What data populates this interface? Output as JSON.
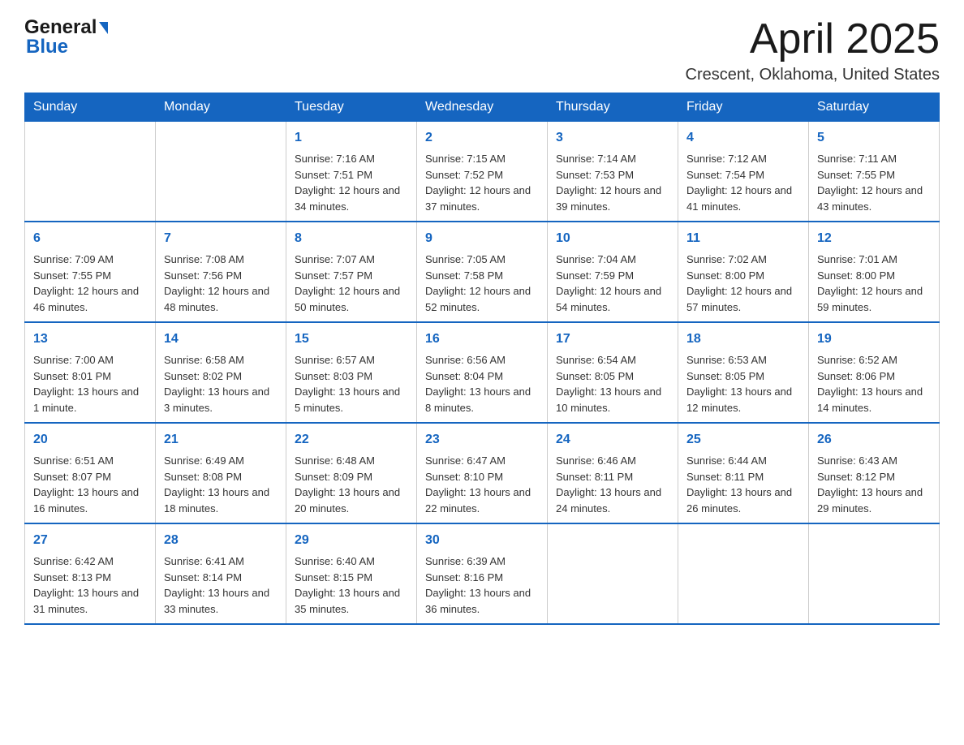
{
  "header": {
    "logo_line1": "General",
    "logo_line2": "Blue",
    "month_title": "April 2025",
    "location": "Crescent, Oklahoma, United States"
  },
  "weekdays": [
    "Sunday",
    "Monday",
    "Tuesday",
    "Wednesday",
    "Thursday",
    "Friday",
    "Saturday"
  ],
  "weeks": [
    [
      {
        "day": "",
        "sunrise": "",
        "sunset": "",
        "daylight": ""
      },
      {
        "day": "",
        "sunrise": "",
        "sunset": "",
        "daylight": ""
      },
      {
        "day": "1",
        "sunrise": "Sunrise: 7:16 AM",
        "sunset": "Sunset: 7:51 PM",
        "daylight": "Daylight: 12 hours and 34 minutes."
      },
      {
        "day": "2",
        "sunrise": "Sunrise: 7:15 AM",
        "sunset": "Sunset: 7:52 PM",
        "daylight": "Daylight: 12 hours and 37 minutes."
      },
      {
        "day": "3",
        "sunrise": "Sunrise: 7:14 AM",
        "sunset": "Sunset: 7:53 PM",
        "daylight": "Daylight: 12 hours and 39 minutes."
      },
      {
        "day": "4",
        "sunrise": "Sunrise: 7:12 AM",
        "sunset": "Sunset: 7:54 PM",
        "daylight": "Daylight: 12 hours and 41 minutes."
      },
      {
        "day": "5",
        "sunrise": "Sunrise: 7:11 AM",
        "sunset": "Sunset: 7:55 PM",
        "daylight": "Daylight: 12 hours and 43 minutes."
      }
    ],
    [
      {
        "day": "6",
        "sunrise": "Sunrise: 7:09 AM",
        "sunset": "Sunset: 7:55 PM",
        "daylight": "Daylight: 12 hours and 46 minutes."
      },
      {
        "day": "7",
        "sunrise": "Sunrise: 7:08 AM",
        "sunset": "Sunset: 7:56 PM",
        "daylight": "Daylight: 12 hours and 48 minutes."
      },
      {
        "day": "8",
        "sunrise": "Sunrise: 7:07 AM",
        "sunset": "Sunset: 7:57 PM",
        "daylight": "Daylight: 12 hours and 50 minutes."
      },
      {
        "day": "9",
        "sunrise": "Sunrise: 7:05 AM",
        "sunset": "Sunset: 7:58 PM",
        "daylight": "Daylight: 12 hours and 52 minutes."
      },
      {
        "day": "10",
        "sunrise": "Sunrise: 7:04 AM",
        "sunset": "Sunset: 7:59 PM",
        "daylight": "Daylight: 12 hours and 54 minutes."
      },
      {
        "day": "11",
        "sunrise": "Sunrise: 7:02 AM",
        "sunset": "Sunset: 8:00 PM",
        "daylight": "Daylight: 12 hours and 57 minutes."
      },
      {
        "day": "12",
        "sunrise": "Sunrise: 7:01 AM",
        "sunset": "Sunset: 8:00 PM",
        "daylight": "Daylight: 12 hours and 59 minutes."
      }
    ],
    [
      {
        "day": "13",
        "sunrise": "Sunrise: 7:00 AM",
        "sunset": "Sunset: 8:01 PM",
        "daylight": "Daylight: 13 hours and 1 minute."
      },
      {
        "day": "14",
        "sunrise": "Sunrise: 6:58 AM",
        "sunset": "Sunset: 8:02 PM",
        "daylight": "Daylight: 13 hours and 3 minutes."
      },
      {
        "day": "15",
        "sunrise": "Sunrise: 6:57 AM",
        "sunset": "Sunset: 8:03 PM",
        "daylight": "Daylight: 13 hours and 5 minutes."
      },
      {
        "day": "16",
        "sunrise": "Sunrise: 6:56 AM",
        "sunset": "Sunset: 8:04 PM",
        "daylight": "Daylight: 13 hours and 8 minutes."
      },
      {
        "day": "17",
        "sunrise": "Sunrise: 6:54 AM",
        "sunset": "Sunset: 8:05 PM",
        "daylight": "Daylight: 13 hours and 10 minutes."
      },
      {
        "day": "18",
        "sunrise": "Sunrise: 6:53 AM",
        "sunset": "Sunset: 8:05 PM",
        "daylight": "Daylight: 13 hours and 12 minutes."
      },
      {
        "day": "19",
        "sunrise": "Sunrise: 6:52 AM",
        "sunset": "Sunset: 8:06 PM",
        "daylight": "Daylight: 13 hours and 14 minutes."
      }
    ],
    [
      {
        "day": "20",
        "sunrise": "Sunrise: 6:51 AM",
        "sunset": "Sunset: 8:07 PM",
        "daylight": "Daylight: 13 hours and 16 minutes."
      },
      {
        "day": "21",
        "sunrise": "Sunrise: 6:49 AM",
        "sunset": "Sunset: 8:08 PM",
        "daylight": "Daylight: 13 hours and 18 minutes."
      },
      {
        "day": "22",
        "sunrise": "Sunrise: 6:48 AM",
        "sunset": "Sunset: 8:09 PM",
        "daylight": "Daylight: 13 hours and 20 minutes."
      },
      {
        "day": "23",
        "sunrise": "Sunrise: 6:47 AM",
        "sunset": "Sunset: 8:10 PM",
        "daylight": "Daylight: 13 hours and 22 minutes."
      },
      {
        "day": "24",
        "sunrise": "Sunrise: 6:46 AM",
        "sunset": "Sunset: 8:11 PM",
        "daylight": "Daylight: 13 hours and 24 minutes."
      },
      {
        "day": "25",
        "sunrise": "Sunrise: 6:44 AM",
        "sunset": "Sunset: 8:11 PM",
        "daylight": "Daylight: 13 hours and 26 minutes."
      },
      {
        "day": "26",
        "sunrise": "Sunrise: 6:43 AM",
        "sunset": "Sunset: 8:12 PM",
        "daylight": "Daylight: 13 hours and 29 minutes."
      }
    ],
    [
      {
        "day": "27",
        "sunrise": "Sunrise: 6:42 AM",
        "sunset": "Sunset: 8:13 PM",
        "daylight": "Daylight: 13 hours and 31 minutes."
      },
      {
        "day": "28",
        "sunrise": "Sunrise: 6:41 AM",
        "sunset": "Sunset: 8:14 PM",
        "daylight": "Daylight: 13 hours and 33 minutes."
      },
      {
        "day": "29",
        "sunrise": "Sunrise: 6:40 AM",
        "sunset": "Sunset: 8:15 PM",
        "daylight": "Daylight: 13 hours and 35 minutes."
      },
      {
        "day": "30",
        "sunrise": "Sunrise: 6:39 AM",
        "sunset": "Sunset: 8:16 PM",
        "daylight": "Daylight: 13 hours and 36 minutes."
      },
      {
        "day": "",
        "sunrise": "",
        "sunset": "",
        "daylight": ""
      },
      {
        "day": "",
        "sunrise": "",
        "sunset": "",
        "daylight": ""
      },
      {
        "day": "",
        "sunrise": "",
        "sunset": "",
        "daylight": ""
      }
    ]
  ]
}
